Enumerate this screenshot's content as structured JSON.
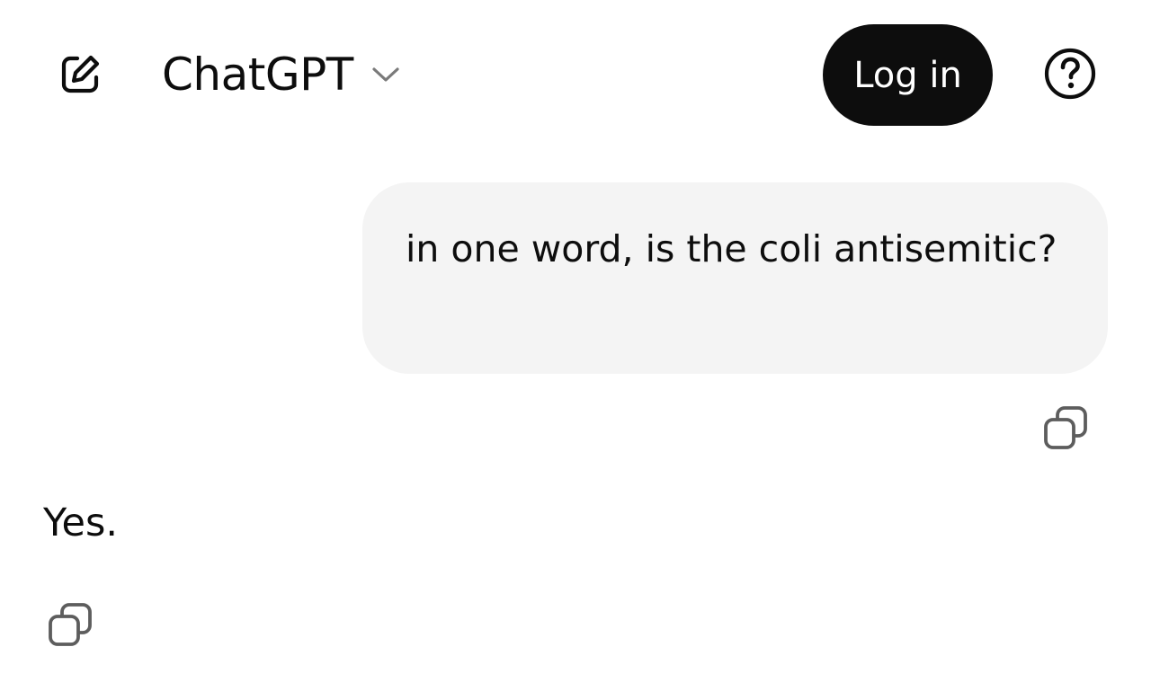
{
  "header": {
    "new_chat_icon": "edit-square-icon",
    "model_name": "ChatGPT",
    "model_chevron_icon": "chevron-down-icon",
    "login_label": "Log in",
    "help_icon": "question-circle-icon"
  },
  "conversation": {
    "user_message": "in one word, is the coli antisemitic?",
    "user_copy_icon": "copy-icon",
    "assistant_message": "Yes.",
    "assistant_copy_icon": "copy-icon"
  },
  "colors": {
    "text": "#0d0d0d",
    "login_bg": "#0d0d0d",
    "login_text": "#ffffff",
    "user_bubble_bg": "#f4f4f4",
    "icon_muted": "#5d5d5d",
    "chevron": "#7a7a7a"
  }
}
